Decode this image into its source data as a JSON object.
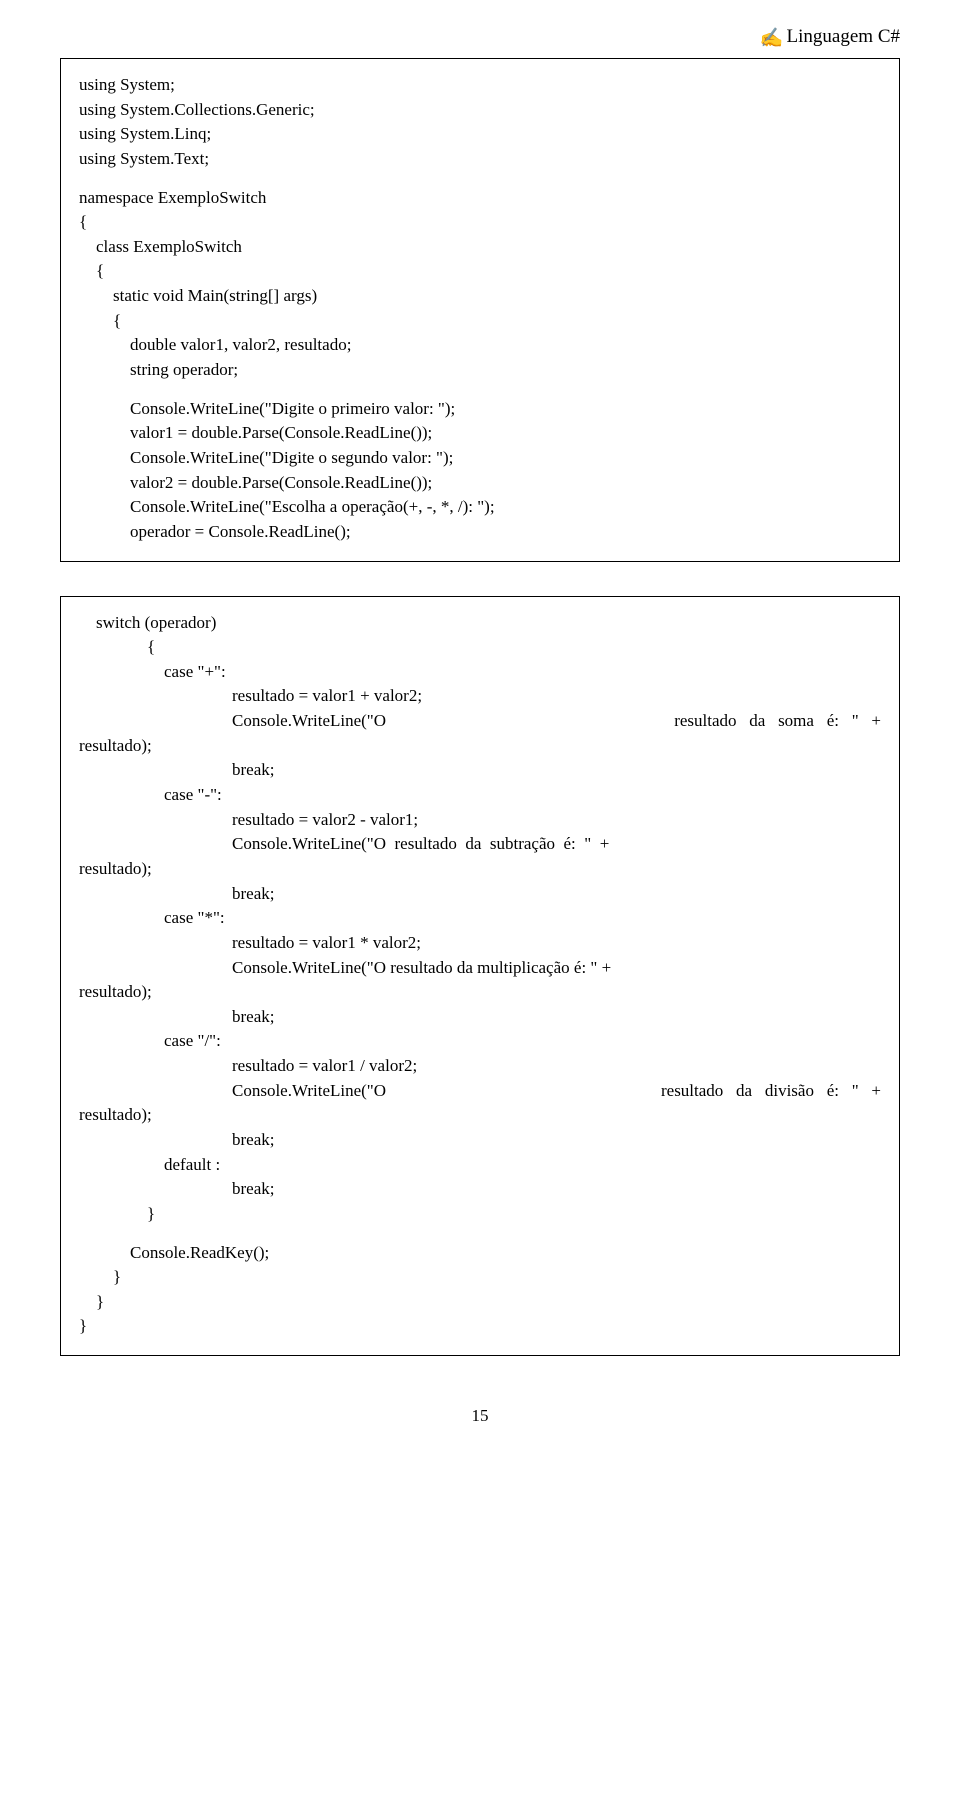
{
  "header": {
    "icon": "✍",
    "title": "Linguagem C#"
  },
  "block1": {
    "l1": "using System;",
    "l2": "using System.Collections.Generic;",
    "l3": "using System.Linq;",
    "l4": "using System.Text;",
    "l5": "namespace ExemploSwitch",
    "l6": "{",
    "l7": "    class ExemploSwitch",
    "l8": "    {",
    "l9": "        static void Main(string[] args)",
    "l10": "        {",
    "l11": "            double valor1, valor2, resultado;",
    "l12": "            string operador;",
    "l13": "            Console.WriteLine(\"Digite o primeiro valor: \");",
    "l14": "            valor1 = double.Parse(Console.ReadLine());",
    "l15": "            Console.WriteLine(\"Digite o segundo valor: \");",
    "l16": "            valor2 = double.Parse(Console.ReadLine());",
    "l17": "            Console.WriteLine(\"Escolha a operação(+, -, *, /): \");",
    "l18": "            operador = Console.ReadLine();"
  },
  "block2": {
    "l1": "    switch (operador)",
    "l2": "                {",
    "l3": "                    case \"+\":",
    "l4": "                                    resultado = valor1 + valor2;",
    "l5a": "                                    Console.WriteLine(\"O",
    "l5b": "resultado   da   soma   é:   \"   +",
    "l6": "resultado);",
    "l7": "                                    break;",
    "l8": "                    case \"-\":",
    "l9": "                                    resultado = valor2 - valor1;",
    "l10a": "                                    Console.WriteLine(\"O  resultado  da  subtração  é:  \"  +",
    "l11": "resultado);",
    "l12": "                                    break;",
    "l13": "                    case \"*\":",
    "l14": "                                    resultado = valor1 * valor2;",
    "l15": "                                    Console.WriteLine(\"O resultado da multiplicação é: \" +",
    "l16": "resultado);",
    "l17": "                                    break;",
    "l18": "                    case \"/\":",
    "l19": "                                    resultado = valor1 / valor2;",
    "l20a": "                                    Console.WriteLine(\"O",
    "l20b": "resultado   da   divisão   é:   \"   +",
    "l21": "resultado);",
    "l22": "                                    break;",
    "l23": "                    default :",
    "l24": "                                    break;",
    "l25": "                }",
    "l26": "            Console.ReadKey();",
    "l27": "        }",
    "l28": "    }",
    "l29": "}"
  },
  "pagenum": "15"
}
